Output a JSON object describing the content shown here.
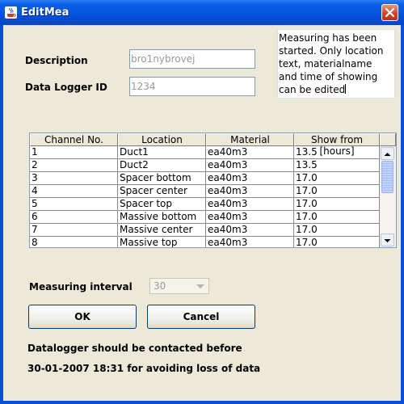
{
  "window": {
    "title": "EditMea"
  },
  "form": {
    "description_label": "Description",
    "description_value": "bro1nybrovej",
    "logger_label": "Data Logger ID",
    "logger_value": "1234",
    "notice_lines": [
      "Measuring has been",
      "started. Only location",
      "text, materialname",
      "and time of showing",
      "can be edited"
    ]
  },
  "table": {
    "columns": [
      "Channel No.",
      "Location",
      "Material",
      "Show from [hours]"
    ],
    "rows": [
      [
        "1",
        "Duct1",
        "ea40m3",
        "13.5"
      ],
      [
        "2",
        "Duct2",
        "ea40m3",
        "13.5"
      ],
      [
        "3",
        "Spacer bottom",
        "ea40m3",
        "17.0"
      ],
      [
        "4",
        "Spacer center",
        "ea40m3",
        "17.0"
      ],
      [
        "5",
        "Spacer top",
        "ea40m3",
        "17.0"
      ],
      [
        "6",
        "Massive bottom",
        "ea40m3",
        "17.0"
      ],
      [
        "7",
        "Massive center",
        "ea40m3",
        "17.0"
      ],
      [
        "8",
        "Massive top",
        "ea40m3",
        "17.0"
      ]
    ]
  },
  "interval": {
    "label": "Measuring interval",
    "value": "30"
  },
  "buttons": {
    "ok": "OK",
    "cancel": "Cancel"
  },
  "messages": {
    "line1": "Datalogger should be contacted before",
    "line2": "30-01-2007 18:31 for avoiding loss of data"
  },
  "colors": {
    "titlebar": "#0552dd",
    "client_bg": "#ece9d8",
    "close_button": "#d0452a"
  }
}
